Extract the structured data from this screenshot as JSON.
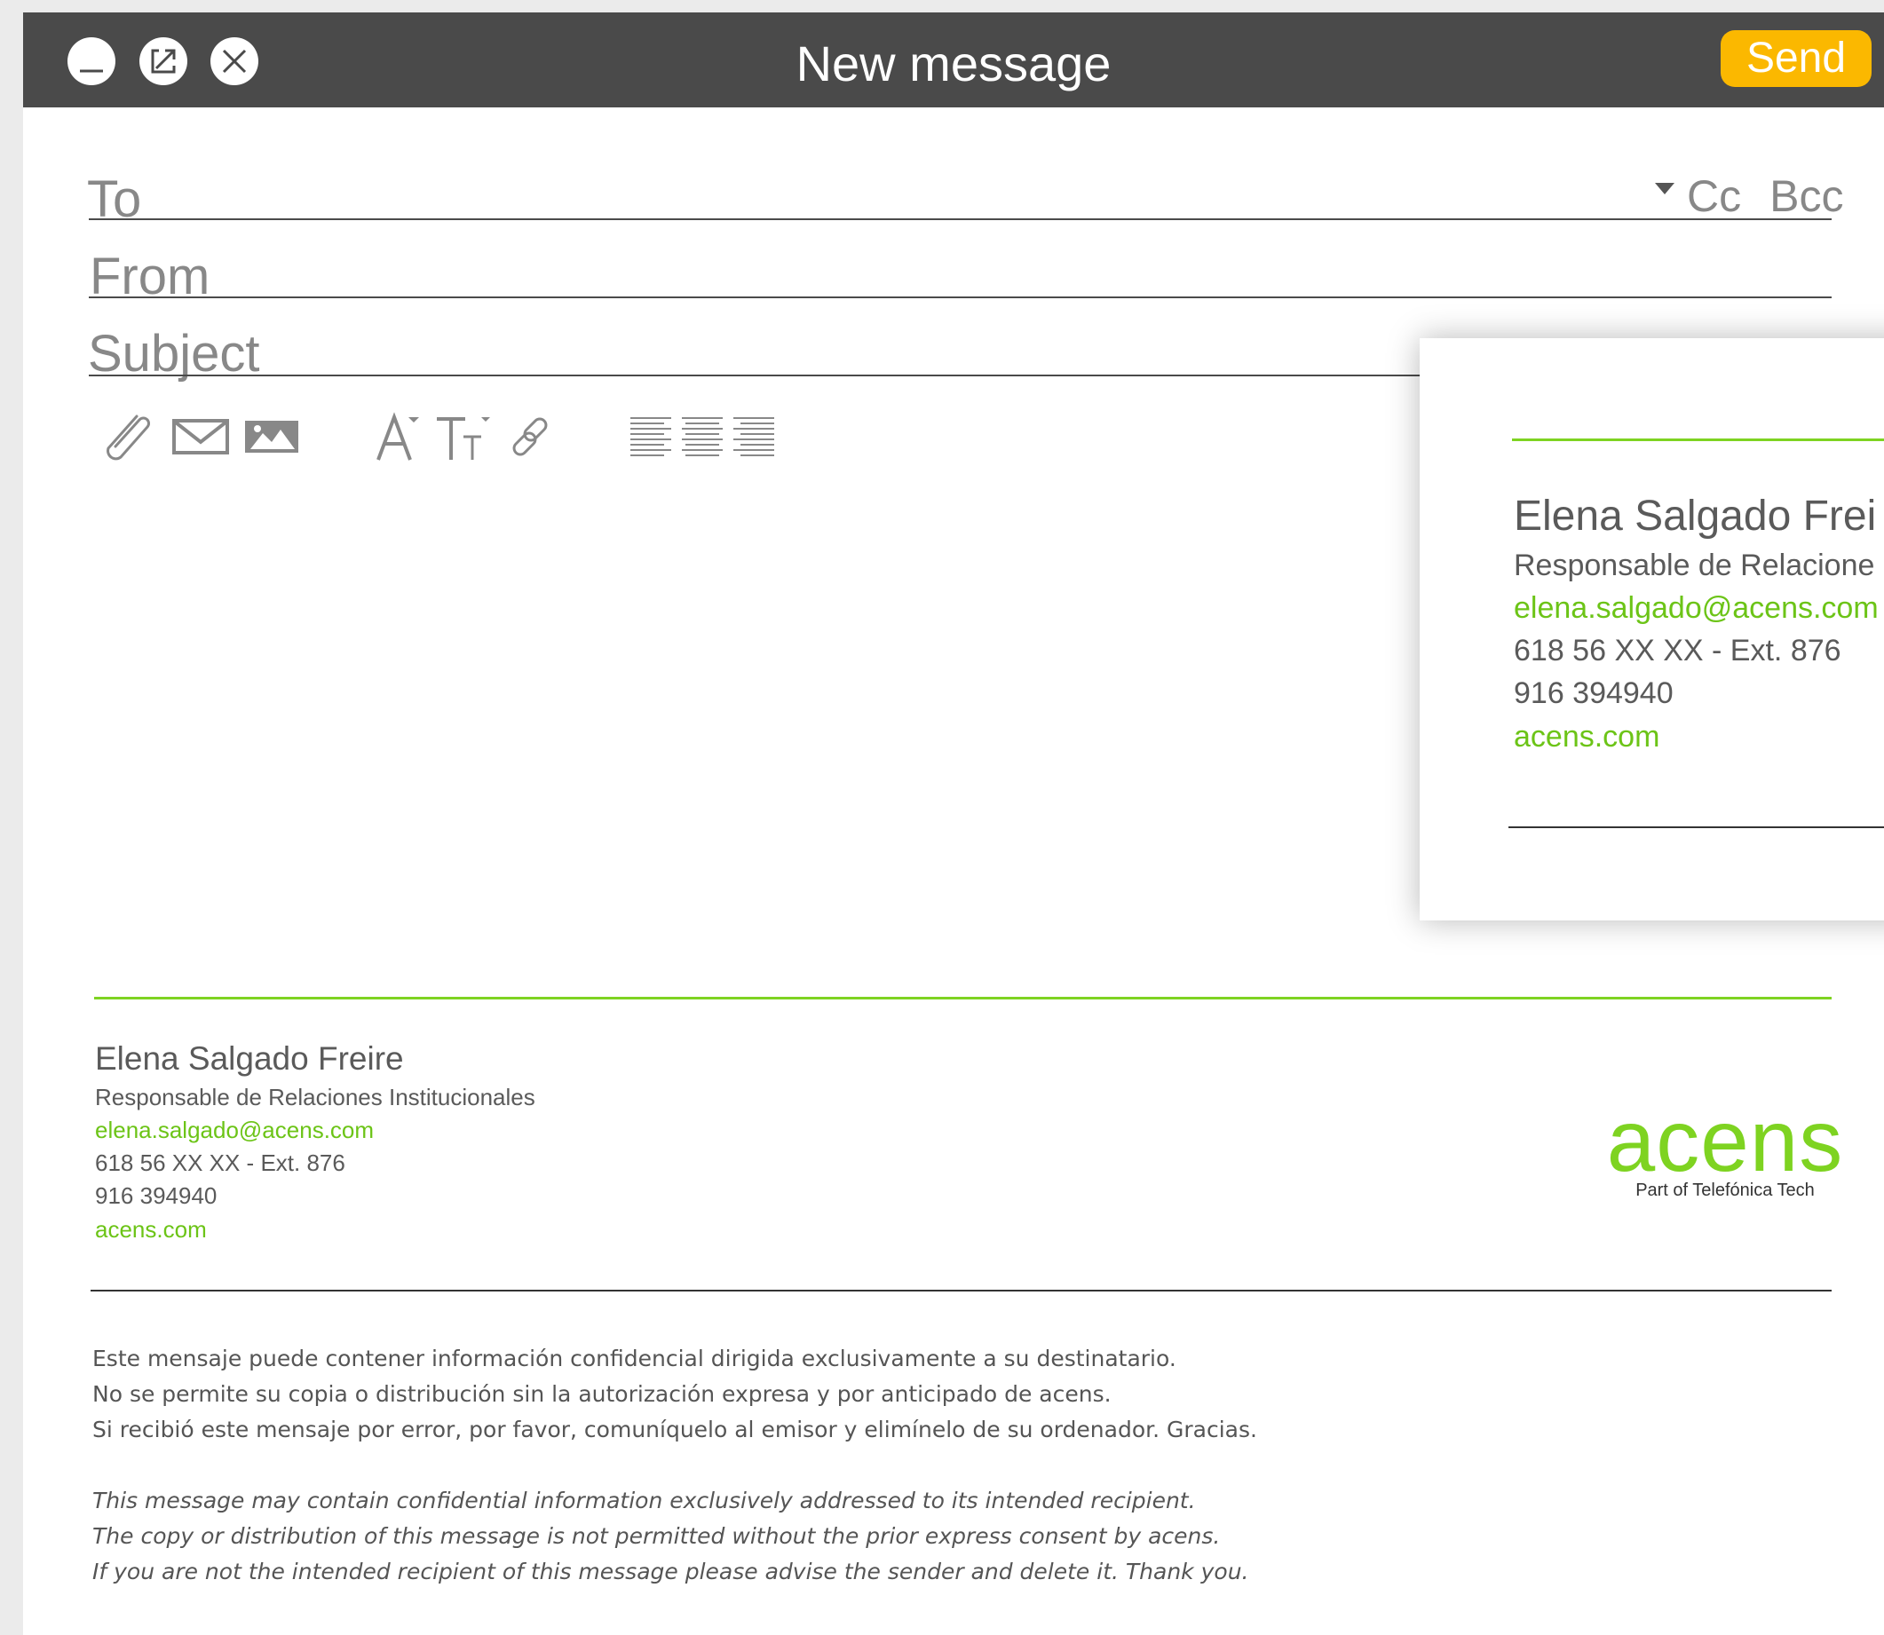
{
  "window": {
    "title": "New message",
    "send_label": "Send"
  },
  "fields": {
    "to_label": "To",
    "from_label": "From",
    "subject_label": "Subject",
    "cc_label": "Cc",
    "bcc_label": "Bcc"
  },
  "toolbar": {
    "icons": [
      "paperclip-icon",
      "envelope-icon",
      "image-icon",
      "font-size-icon",
      "text-style-icon",
      "link-icon",
      "align-left-icon",
      "align-center-icon",
      "align-right-icon"
    ]
  },
  "signature": {
    "name": "Elena Salgado Freire",
    "role": "Responsable de Relaciones Institucionales",
    "email": "elena.salgado@acens.com",
    "phone": "618 56 XX XX - Ext. 876",
    "landline": "916 394940",
    "web": "acens.com"
  },
  "popup": {
    "name": "Elena Salgado Frei",
    "role": "Responsable de Relacione",
    "email": "elena.salgado@acens.com",
    "phone": "618 56 XX XX - Ext. 876",
    "landline": "916 394940",
    "web": "acens.com"
  },
  "logo": {
    "word": "acens",
    "tagline": "Part of Telefónica Tech"
  },
  "legal": {
    "es": [
      "Este mensaje puede contener información confidencial dirigida exclusivamente a su destinatario.",
      "No se permite su copia o distribución sin la autorización expresa y por anticipado de acens.",
      "Si recibió este mensaje por error, por favor, comuníquelo al emisor y elimínelo de su ordenador. Gracias."
    ],
    "en": [
      "This message may contain confidential information exclusively addressed to its intended recipient.",
      "The copy or distribution of this message is not permitted without the prior express consent by acens.",
      "If you are not the intended recipient of this message please advise the sender and delete it. Thank you."
    ]
  },
  "colors": {
    "titlebar": "#4a4a4a",
    "send": "#fbb800",
    "accent_green": "#7ed321",
    "link_green": "#6cc417",
    "text_gray": "#5a5a5a"
  }
}
